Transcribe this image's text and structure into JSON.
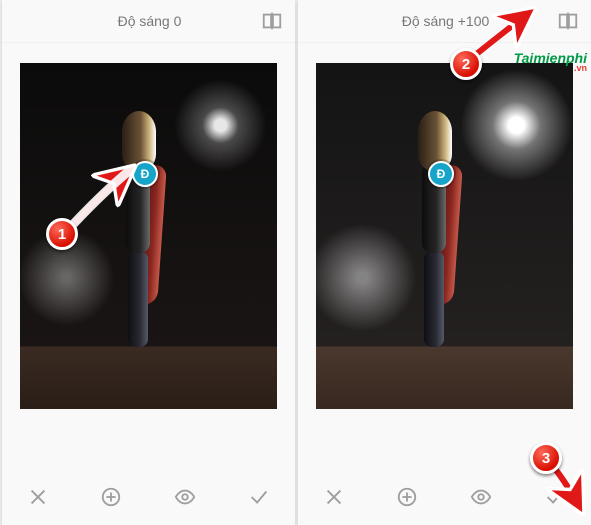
{
  "left": {
    "brightness_label": "Độ sáng 0",
    "compare_icon": "compare-icon"
  },
  "right": {
    "brightness_label": "Độ sáng +100",
    "compare_icon": "compare-icon"
  },
  "toolbar": {
    "close": "×",
    "add": "+",
    "view": "eye",
    "confirm": "✓"
  },
  "callouts": {
    "one": "1",
    "two": "2",
    "three": "3",
    "dot_label": "Đ"
  },
  "watermark": {
    "main": "Taimienphi",
    "suffix": ".vn"
  }
}
